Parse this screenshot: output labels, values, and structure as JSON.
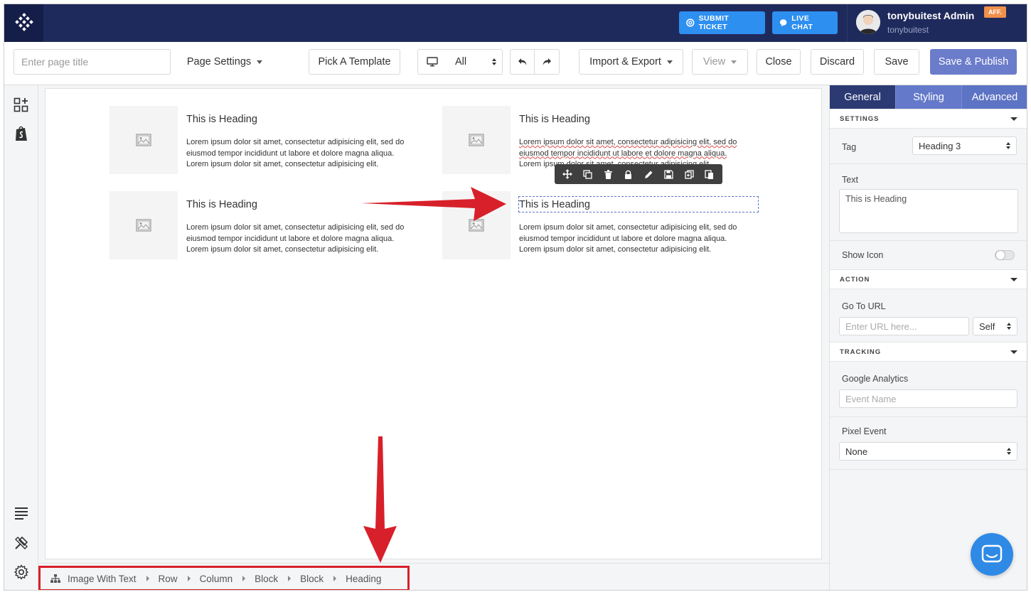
{
  "header": {
    "submit_ticket": "SUBMIT TICKET",
    "live_chat": "LIVE CHAT",
    "user_name": "tonybuitest Admin",
    "user_handle": "tonybuitest",
    "aff_badge": "AFF."
  },
  "toolbar": {
    "page_title_placeholder": "Enter page title",
    "page_settings": "Page Settings",
    "pick_template": "Pick A Template",
    "device": "All",
    "import_export": "Import & Export",
    "view": "View",
    "close": "Close",
    "discard": "Discard",
    "save": "Save",
    "save_publish": "Save & Publish"
  },
  "canvas": {
    "cards": [
      {
        "heading": "This is Heading",
        "line1": "Lorem ipsum dolor sit amet, consectetur adipisicing elit, sed do",
        "line2": "eiusmod tempor incididunt ut labore et dolore magna aliqua.",
        "line3": "Lorem ipsum dolor sit amet, consectetur adipisicing elit."
      },
      {
        "heading": "This is Heading",
        "line1": "Lorem ipsum dolor sit amet, consectetur adipisicing elit, sed do",
        "line2": "eiusmod tempor incididunt ut labore et dolore magna aliqua.",
        "line3": "Lorem ipsum dolor sit amet, consectetur adipisicing elit."
      },
      {
        "heading": "This is Heading",
        "line1": "Lorem ipsum dolor sit amet, consectetur adipisicing elit, sed do",
        "line2": "eiusmod tempor incididunt ut labore et dolore magna aliqua.",
        "line3": "Lorem ipsum dolor sit amet, consectetur adipisicing elit."
      },
      {
        "heading": "This is Heading",
        "line1": "Lorem ipsum dolor sit amet, consectetur adipisicing elit, sed do",
        "line2": "eiusmod tempor incididunt ut labore et dolore magna aliqua.",
        "line3": "Lorem ipsum dolor sit amet, consectetur adipisicing elit."
      }
    ],
    "element_toolbar_icons": [
      "move-icon",
      "copy-icon",
      "trash-icon",
      "lock-icon",
      "edit-icon",
      "save-icon",
      "duplicate-icon",
      "paste-icon"
    ]
  },
  "breadcrumb": [
    "Image With Text",
    "Row",
    "Column",
    "Block",
    "Block",
    "Heading"
  ],
  "panel": {
    "tabs": [
      "General",
      "Styling",
      "Advanced"
    ],
    "settings_title": "SETTINGS",
    "tag_label": "Tag",
    "tag_value": "Heading 3",
    "text_label": "Text",
    "text_value": "This is Heading",
    "show_icon_label": "Show Icon",
    "action_title": "ACTION",
    "go_to_url_label": "Go To URL",
    "url_placeholder": "Enter URL here...",
    "target_value": "Self",
    "tracking_title": "TRACKING",
    "ga_label": "Google Analytics",
    "event_placeholder": "Event Name",
    "pixel_label": "Pixel Event",
    "pixel_value": "None"
  },
  "colors": {
    "navbar": "#1f2a5c",
    "accent_blue": "#2d8ff0",
    "publish": "#6b7ccb",
    "annotation_red": "#d8202a"
  }
}
